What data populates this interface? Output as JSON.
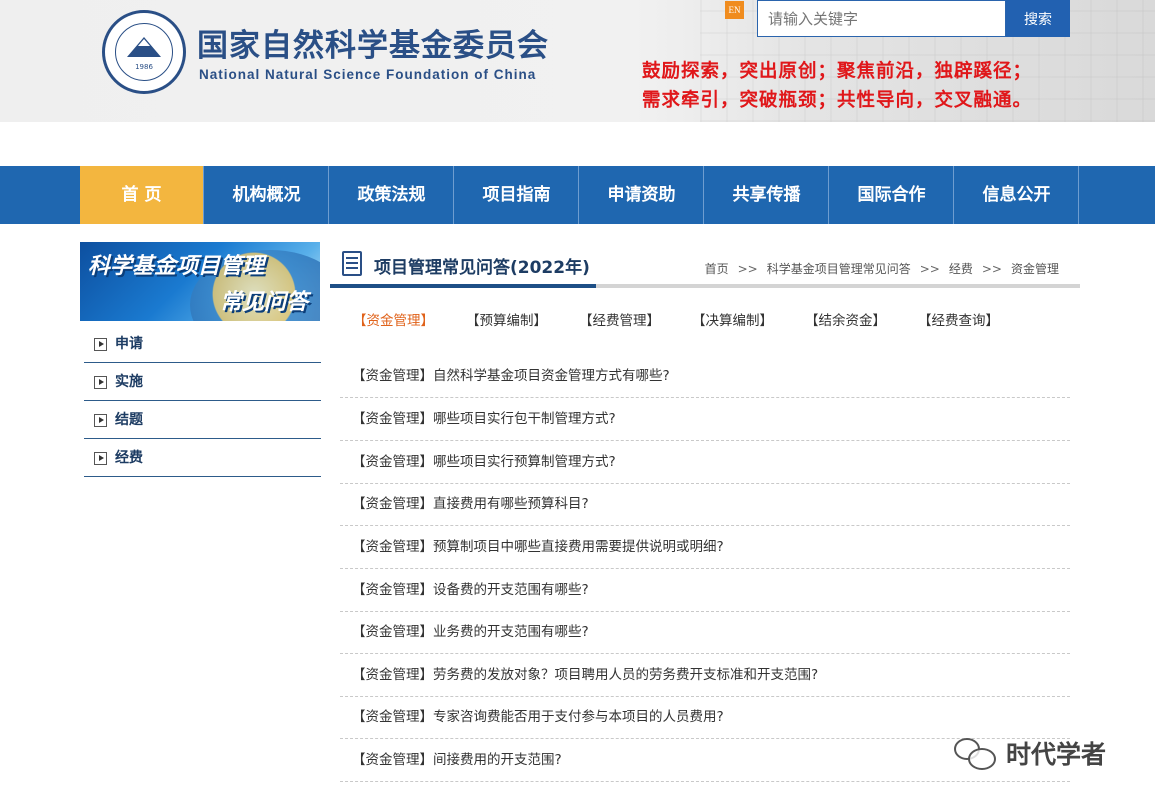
{
  "header": {
    "logo_year": "1986",
    "site_title_cn": "国家自然科学基金委员会",
    "site_title_en": "National Natural Science Foundation of China",
    "en_label": "EN",
    "search_placeholder": "请输入关键字",
    "search_button": "搜索",
    "slogan_line1": "鼓励探索，突出原创；聚焦前沿，独辟蹊径；",
    "slogan_line2": "需求牵引，突破瓶颈；共性导向，交叉融通。"
  },
  "nav": {
    "items": [
      "首 页",
      "机构概况",
      "政策法规",
      "项目指南",
      "申请资助",
      "共享传播",
      "国际合作",
      "信息公开"
    ],
    "active_index": 0
  },
  "sidebar": {
    "banner_line1": "科学基金项目管理",
    "banner_line2": "常见问答",
    "items": [
      "申请",
      "实施",
      "结题",
      "经费"
    ]
  },
  "main": {
    "title": "项目管理常见问答(2022年)",
    "breadcrumb": [
      "首页",
      "科学基金项目管理常见问答",
      "经费",
      "资金管理"
    ],
    "breadcrumb_sep": ">>",
    "tabs": [
      "【资金管理】",
      "【预算编制】",
      "【经费管理】",
      "【决算编制】",
      "【结余资金】",
      "【经费查询】"
    ],
    "active_tab": 0,
    "questions": [
      "【资金管理】自然科学基金项目资金管理方式有哪些?",
      "【资金管理】哪些项目实行包干制管理方式?",
      "【资金管理】哪些项目实行预算制管理方式?",
      "【资金管理】直接费用有哪些预算科目?",
      "【资金管理】预算制项目中哪些直接费用需要提供说明或明细?",
      "【资金管理】设备费的开支范围有哪些?",
      "【资金管理】业务费的开支范围有哪些?",
      "【资金管理】劳务费的发放对象？项目聘用人员的劳务费开支标准和开支范围?",
      "【资金管理】专家咨询费能否用于支付参与本项目的人员费用?",
      "【资金管理】间接费用的开支范围?"
    ]
  },
  "watermark": {
    "icon": "wechat-icon",
    "text": "时代学者"
  },
  "colors": {
    "nav_bg": "#1f67b0",
    "nav_active": "#f3b63f",
    "slogan": "#e0171a",
    "title_blue": "#2a4f86",
    "tab_active": "#e0621a"
  }
}
